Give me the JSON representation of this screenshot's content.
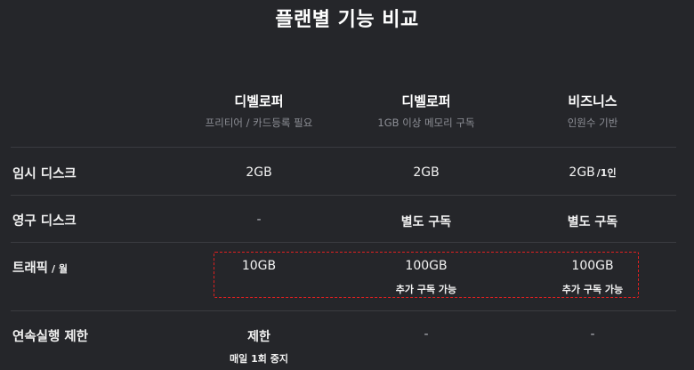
{
  "title": "플랜별 기능 비교",
  "plans": [
    {
      "name": "디벨로퍼",
      "desc": "프리티어 / 카드등록 필요"
    },
    {
      "name": "디벨로퍼",
      "desc": "1GB 이상 메모리 구독"
    },
    {
      "name": "비즈니스",
      "desc": "인원수 기반"
    }
  ],
  "rows": [
    {
      "label": "임시 디스크",
      "cells": [
        {
          "value": "2GB"
        },
        {
          "value": "2GB"
        },
        {
          "value": "2GB",
          "unit": "/1인"
        }
      ]
    },
    {
      "label": "영구 디스크",
      "cells": [
        {
          "value": "-"
        },
        {
          "value": "별도 구독"
        },
        {
          "value": "별도 구독"
        }
      ]
    },
    {
      "label": "트래픽",
      "unit": "/ 월",
      "cells": [
        {
          "value": "10GB"
        },
        {
          "value": "100GB",
          "sub": "추가 구독 가능"
        },
        {
          "value": "100GB",
          "sub": "추가 구독 가능"
        }
      ]
    },
    {
      "label": "연속실행 제한",
      "cells": [
        {
          "value": "제한",
          "sub": "매일 1회 중지"
        },
        {
          "value": "-"
        },
        {
          "value": "-"
        }
      ]
    }
  ],
  "colors": {
    "background": "#25262a",
    "divider": "#3a3b40",
    "highlight_border": "#e02020"
  }
}
